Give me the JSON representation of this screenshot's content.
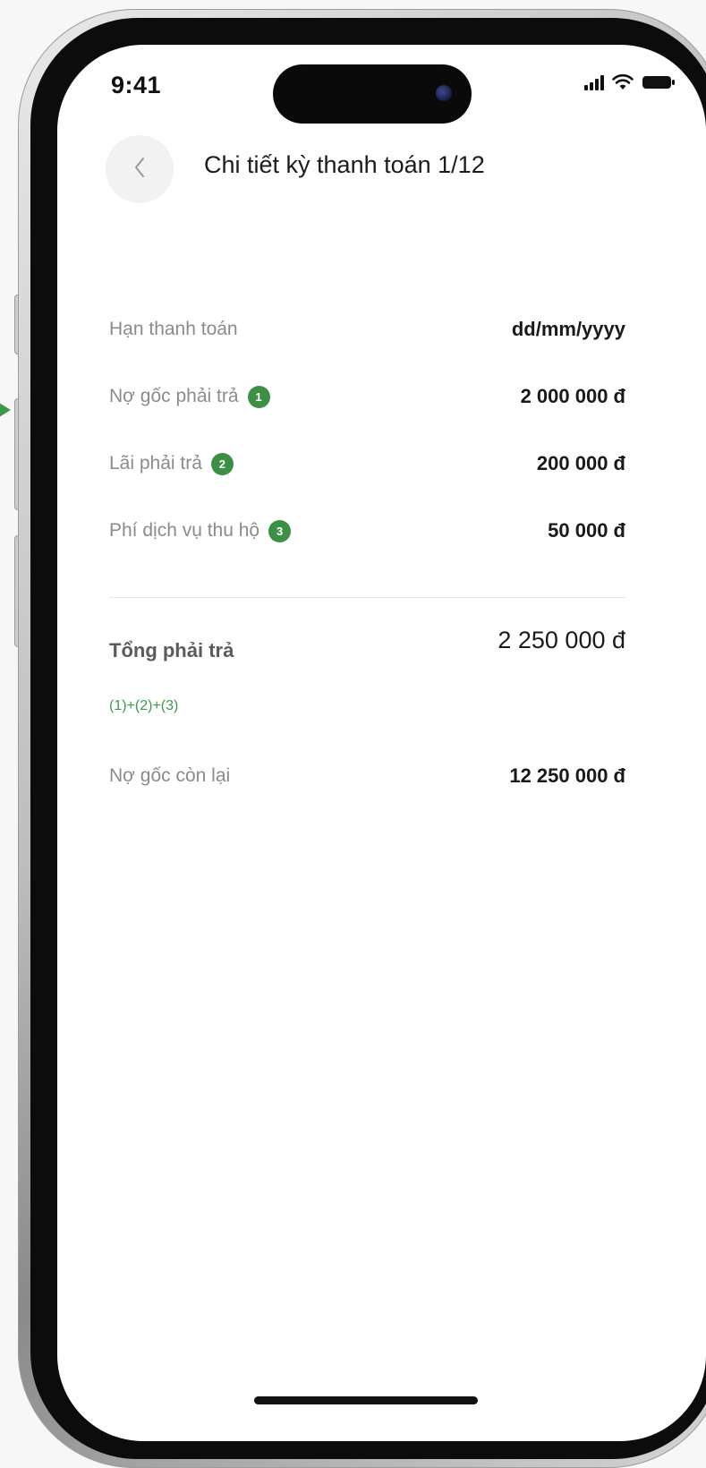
{
  "status_bar": {
    "time": "9:41"
  },
  "header": {
    "back_icon": "chevron-left-icon",
    "title": "Chi tiết kỳ thanh toán 1/12"
  },
  "details": {
    "rows": [
      {
        "label": "Hạn thanh toán",
        "badge": "",
        "value": "dd/mm/yyyy"
      },
      {
        "label": "Nợ gốc phải trả",
        "badge": "1",
        "value": "2 000 000 đ"
      },
      {
        "label": "Lãi phải trả",
        "badge": "2",
        "value": "200 000 đ"
      },
      {
        "label": "Phí dịch vụ thu hộ",
        "badge": "3",
        "value": "50 000 đ"
      }
    ],
    "total": {
      "label": "Tổng phải trả",
      "value": "2 250 000 đ",
      "formula": "(1)+(2)+(3)"
    },
    "remaining": {
      "label": "Nợ gốc còn lại",
      "value": "12 250 000 đ"
    }
  },
  "colors": {
    "accent_green": "#3c8f45",
    "formula_green": "#3c9a4a",
    "label_gray": "#8b8b8b",
    "value_dark": "#1a1a1a"
  }
}
